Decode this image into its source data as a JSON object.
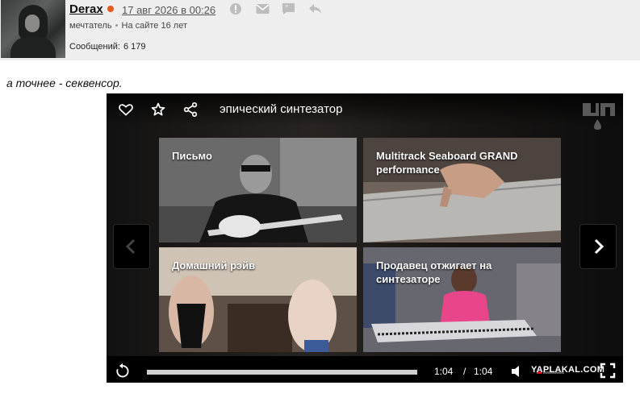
{
  "post": {
    "username": "Derax",
    "date": "17 авг 2026 в 00:26",
    "role": "мечтатель",
    "separator": "•",
    "on_site": "На сайте 16 лет",
    "messages_label": "Сообщений:",
    "messages_count": "6 179",
    "text": "а точнее - секвенсор."
  },
  "icons": {
    "header": [
      "info-icon",
      "mail-icon",
      "quote-icon",
      "reply-icon"
    ],
    "player_top": [
      "heart-icon",
      "star-icon",
      "share-icon"
    ],
    "player_bottom": [
      "replay-icon",
      "volume-icon",
      "fullscreen-icon"
    ]
  },
  "player": {
    "title": "эпический синтезатор",
    "time_current": "1:04",
    "time_separator": "/",
    "time_total": "1:04",
    "progress": 1.0,
    "watermark": "YAPLAKAL.COM",
    "tiles": [
      {
        "label": "Письмо"
      },
      {
        "label": "Multitrack Seaboard GRAND performance"
      },
      {
        "label": "Домашний рэйв"
      },
      {
        "label": "Продавец отжигает на синтезаторе"
      }
    ]
  },
  "colors": {
    "online_dot": "#e8571e",
    "header_bg": "#eeeeee",
    "player_bg": "#0f0f10"
  }
}
